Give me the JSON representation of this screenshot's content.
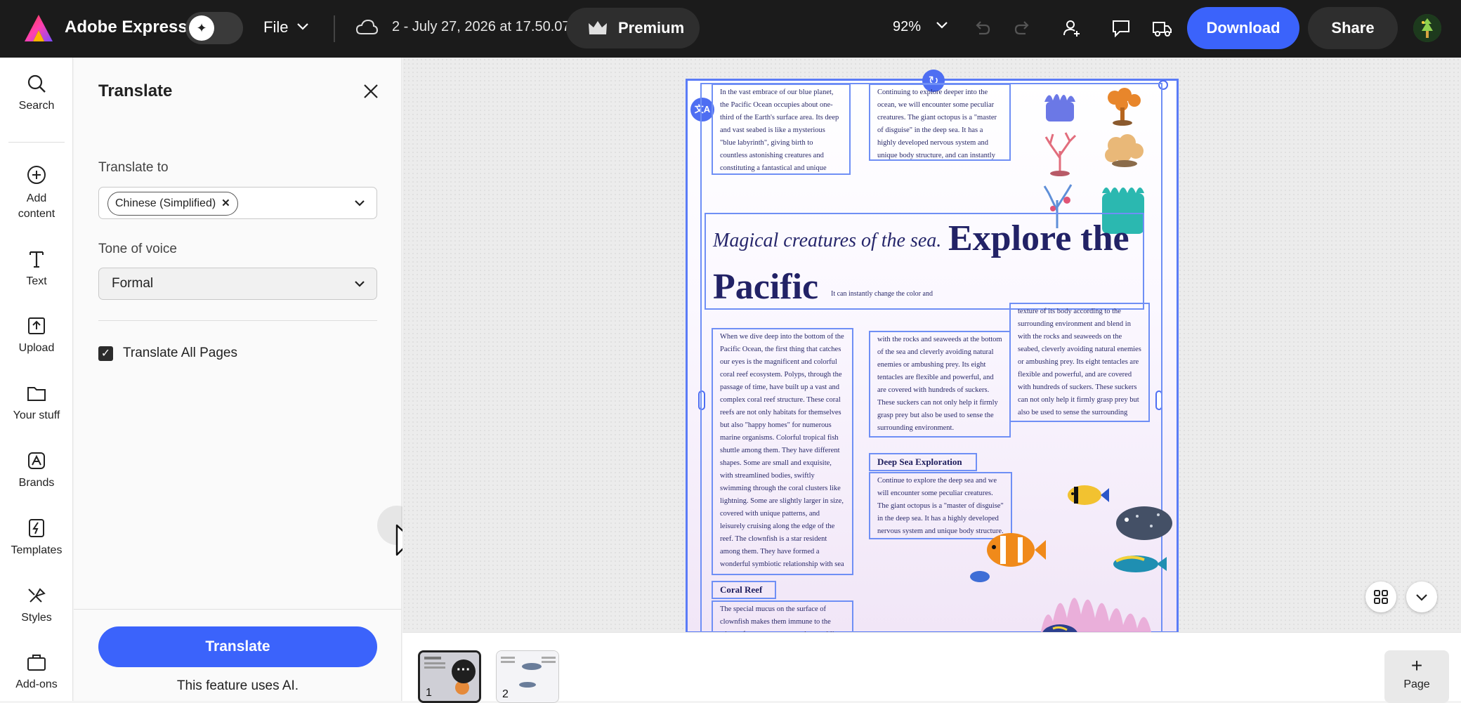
{
  "topbar": {
    "brand": "Adobe Express",
    "file_label": "File",
    "doc_name": "2 - July 27, 2026 at 17.50.07",
    "premium_label": "Premium",
    "zoom": "92%",
    "download_label": "Download",
    "share_label": "Share"
  },
  "rail": {
    "items": [
      {
        "label": "Search",
        "icon": "search-icon"
      },
      {
        "label": "Add\ncontent",
        "icon": "add-circle-icon"
      },
      {
        "label": "Text",
        "icon": "text-icon"
      },
      {
        "label": "Upload",
        "icon": "upload-icon"
      },
      {
        "label": "Your stuff",
        "icon": "folder-icon"
      },
      {
        "label": "Brands",
        "icon": "brand-icon"
      },
      {
        "label": "Templates",
        "icon": "templates-icon"
      },
      {
        "label": "Styles",
        "icon": "styles-icon"
      },
      {
        "label": "Add-ons",
        "icon": "addons-icon"
      }
    ]
  },
  "panel": {
    "title": "Translate",
    "translate_to_label": "Translate to",
    "language_chip": "Chinese (Simplified)",
    "tone_label": "Tone of voice",
    "tone_value": "Formal",
    "translate_all_label": "Translate All Pages",
    "translate_all_checked": true,
    "translate_button": "Translate",
    "ai_note": "This feature uses AI."
  },
  "doc": {
    "hero_sub": "Magical creatures of the sea.",
    "hero_title_1": "Explore the",
    "hero_title_2": "Pacific",
    "hero_note": "It can instantly change the color and",
    "p1": "In the vast embrace of our blue planet, the Pacific Ocean occupies about one-third of the Earth's surface area. Its deep and vast seabed is like a mysterious \"blue labyrinth\", giving birth to countless astonishing creatures and constituting a fantastical and unique ecosystem.",
    "p2": "Continuing to explore deeper into the ocean, we will encounter some peculiar creatures. The giant octopus is a \"master of disguise\" in the deep sea. It has a highly developed nervous system and unique body structure, and can instantly change the color and texture of its body according to the surrounding environment, blending in",
    "p3": "texture of its body according to the surrounding environment and blend in with the rocks and seaweeds on the seabed, cleverly avoiding natural enemies or ambushing prey. Its eight tentacles are flexible and powerful, and are covered with hundreds of suckers. These suckers can not only help it firmly grasp prey but also be used to sense the surrounding environment.",
    "p4": "When we dive deep into the bottom of the Pacific Ocean, the first thing that catches our eyes is the magnificent and colorful coral reef ecosystem. Polyps, through the passage of time, have built up a vast and complex coral reef structure. These coral reefs are not only habitats for themselves but also \"happy homes\" for numerous marine organisms. Colorful tropical fish shuttle among them. They have different shapes. Some are small and exquisite, with streamlined bodies, swiftly swimming through the coral clusters like lightning. Some are slightly larger in size, covered with unique patterns, and leisurely cruising along the edge of the reef. The clownfish is a star resident among them. They have formed a wonderful symbiotic relationship with sea anemones.",
    "p5": "with the rocks and seaweeds at the bottom of the sea and cleverly avoiding natural enemies or ambushing prey. Its eight tentacles are flexible and powerful, and are covered with hundreds of suckers. These suckers can not only help it firmly grasp prey but also be used to sense the surrounding environment.",
    "deep_sea_heading": "Deep Sea Exploration",
    "p6": "Continue to explore the deep sea and we will encounter some peculiar creatures. The giant octopus is a \"master of disguise\" in the deep sea. It has a highly developed nervous system and unique body structure.",
    "coral_heading": "Coral Reef",
    "p7": "The special mucus on the surface of clownfish makes them immune to the stings of sea anemone tentacles, enabling"
  },
  "strip": {
    "thumb1_num": "1",
    "thumb2_num": "2",
    "page_label": "Page"
  },
  "colors": {
    "accent": "#3b63fb",
    "selection": "#4e6ef2",
    "topbar_bg": "#1b1b1b"
  }
}
